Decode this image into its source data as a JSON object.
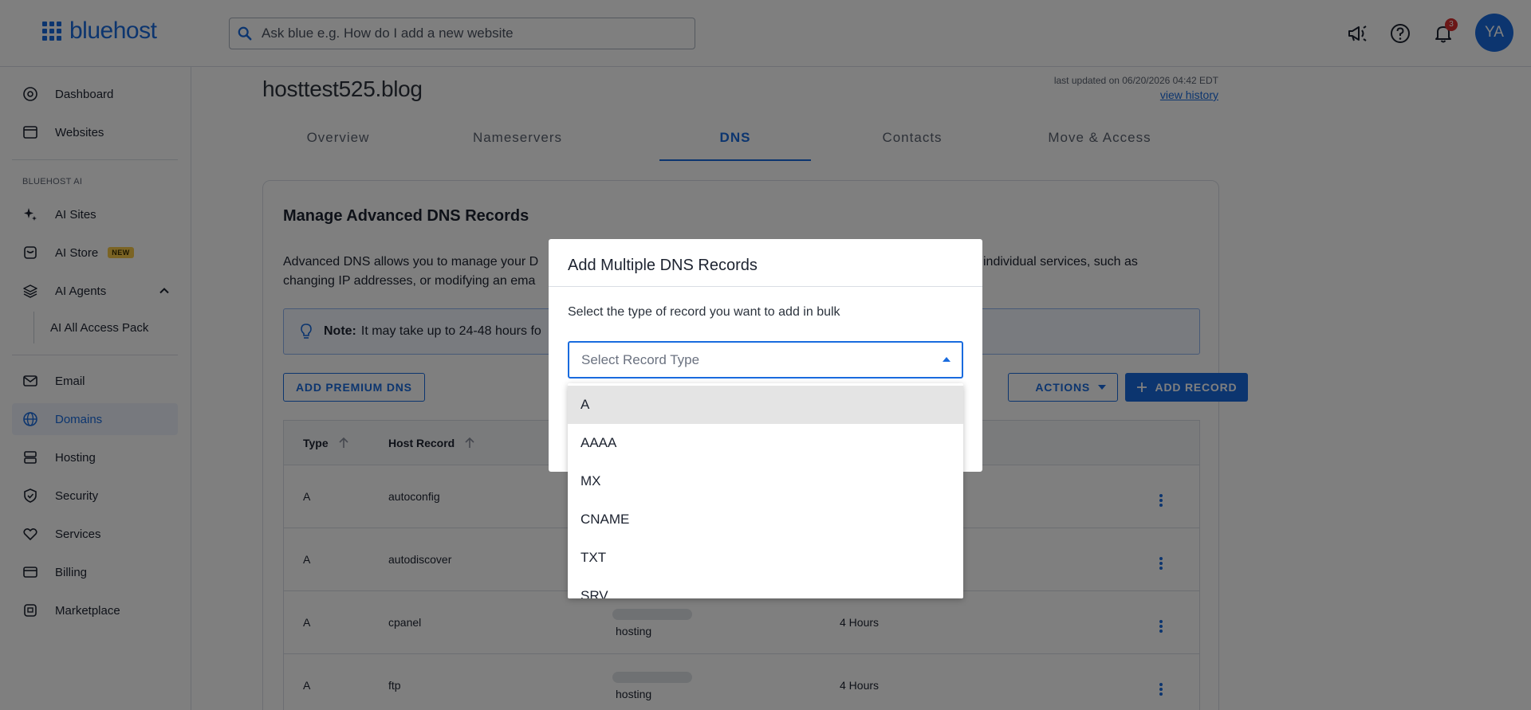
{
  "header": {
    "logo_text": "bluehost",
    "search_placeholder": "Ask blue e.g. How do I add a new website",
    "notifications_count": "3",
    "avatar_initials": "YA"
  },
  "sidebar": {
    "items_top": [
      {
        "label": "Dashboard",
        "icon": "dashboard-icon"
      },
      {
        "label": "Websites",
        "icon": "websites-icon"
      }
    ],
    "section_label": "BLUEHOST AI",
    "ai_items": [
      {
        "label": "AI Sites",
        "icon": "sparkle-icon"
      },
      {
        "label": "AI Store",
        "icon": "store-icon",
        "badge": "NEW"
      },
      {
        "label": "AI Agents",
        "icon": "layers-icon"
      }
    ],
    "ai_sub_item": "AI All Access Pack",
    "items_bottom": [
      {
        "label": "Email",
        "icon": "email-icon"
      },
      {
        "label": "Domains",
        "icon": "globe-icon",
        "active": true
      },
      {
        "label": "Hosting",
        "icon": "hosting-icon"
      },
      {
        "label": "Security",
        "icon": "shield-icon"
      },
      {
        "label": "Services",
        "icon": "services-icon"
      },
      {
        "label": "Billing",
        "icon": "billing-icon"
      },
      {
        "label": "Marketplace",
        "icon": "marketplace-icon"
      }
    ]
  },
  "main": {
    "domain": "hosttest525.blog",
    "last_updated": "last updated on 06/20/2026 04:42 EDT",
    "view_history": "view history",
    "tabs": [
      {
        "label": "Overview"
      },
      {
        "label": "Nameservers"
      },
      {
        "label": "DNS",
        "active": true
      },
      {
        "label": "Contacts"
      },
      {
        "label": "Move & Access"
      }
    ],
    "card": {
      "title": "Manage Advanced DNS Records",
      "description_left": "Advanced DNS allows you to manage your D",
      "description_right": "individual services, such as",
      "description_line2": "changing IP addresses, or modifying an ema",
      "note_label": "Note:",
      "note_text": "It may take up to 24-48 hours fo",
      "add_premium_dns": "ADD PREMIUM DNS",
      "actions": "ACTIONS",
      "add_record": "ADD RECORD",
      "table": {
        "headers": [
          "Type",
          "Host Record"
        ],
        "rows": [
          {
            "type": "A",
            "host": "autoconfig",
            "points_to": "",
            "ttl": ""
          },
          {
            "type": "A",
            "host": "autodiscover",
            "points_to": "",
            "ttl": ""
          },
          {
            "type": "A",
            "host": "cpanel",
            "points_to": "hosting",
            "ttl": "4 Hours"
          },
          {
            "type": "A",
            "host": "ftp",
            "points_to": "hosting",
            "ttl": "4 Hours"
          }
        ]
      }
    }
  },
  "modal": {
    "title": "Add Multiple DNS Records",
    "instruction": "Select the type of record you want to add in bulk",
    "select_placeholder": "Select Record Type",
    "options": [
      "A",
      "AAAA",
      "MX",
      "CNAME",
      "TXT",
      "SRV"
    ],
    "highlighted_option": "A"
  },
  "colors": {
    "brand": "#196bde",
    "overlay": "rgba(0,0,0,0.5)"
  }
}
